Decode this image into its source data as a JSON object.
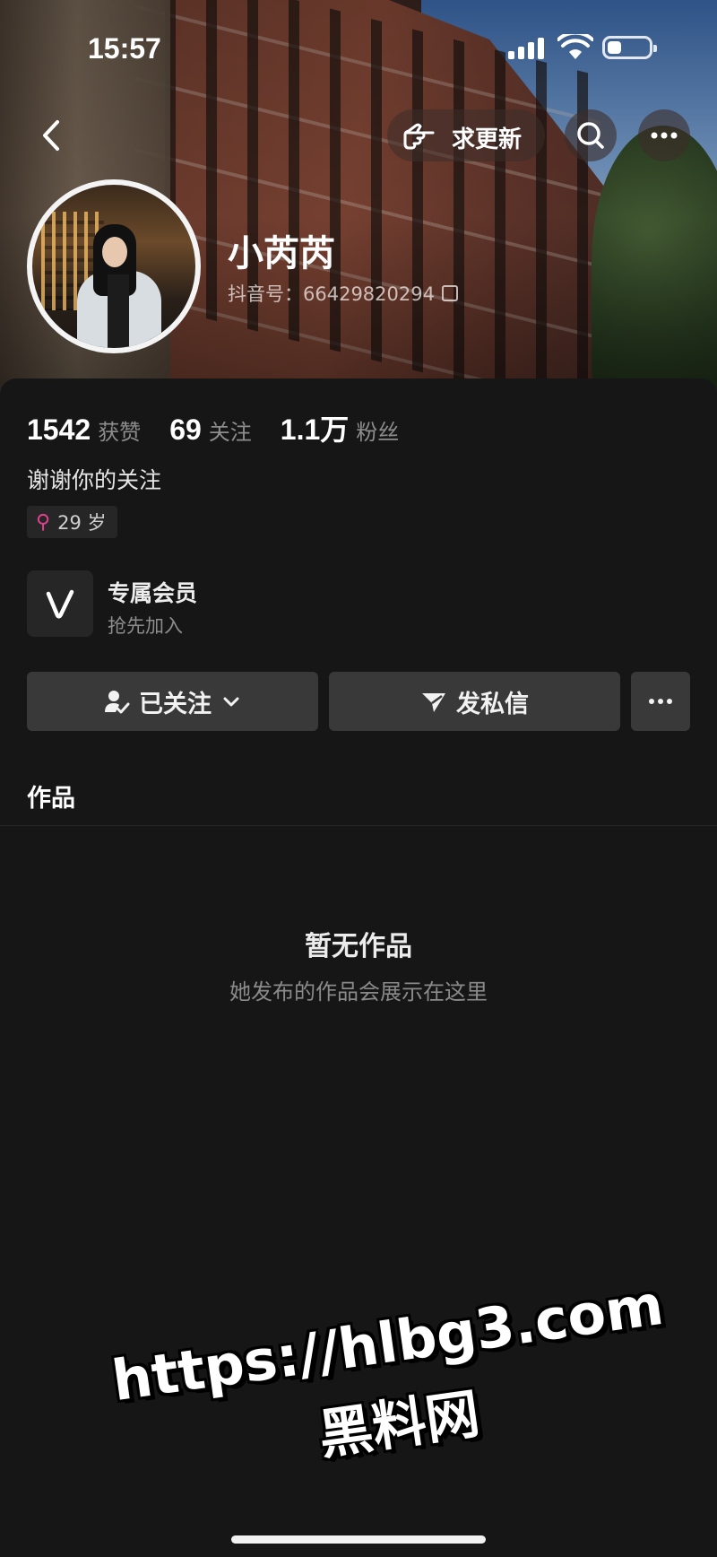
{
  "status_bar": {
    "time": "15:57",
    "signal_bars": 4,
    "battery_level": 0.35
  },
  "header": {
    "request_update_label": "求更新",
    "back_icon": "chevron-left-icon",
    "search_icon": "search-icon",
    "more_icon": "more-dots-icon"
  },
  "profile": {
    "name": "小芮芮",
    "douyin_id": "抖音号：66429820294",
    "bio": "谢谢你的关注",
    "age_tag": "29 岁",
    "gender_icon": "female-symbol-icon",
    "gender_color": "#e0428f"
  },
  "stats": [
    {
      "value": "1542",
      "label": "获赞"
    },
    {
      "value": "69",
      "label": "关注"
    },
    {
      "value": "1.1万",
      "label": "粉丝"
    }
  ],
  "membership": {
    "title": "专属会员",
    "subtitle": "抢先加入",
    "icon": "v-badge-icon"
  },
  "actions": {
    "followed_label": "已关注",
    "message_label": "发私信",
    "more_icon": "more-dots-icon"
  },
  "works": {
    "section_title": "作品",
    "empty_title": "暂无作品",
    "empty_subtitle": "她发布的作品会展示在这里"
  },
  "watermark": {
    "url": "https://hlbg3.com",
    "site_name": "黑料网"
  },
  "colors": {
    "background": "#161616",
    "button": "#393939",
    "muted_text": "#8d8d8d"
  }
}
